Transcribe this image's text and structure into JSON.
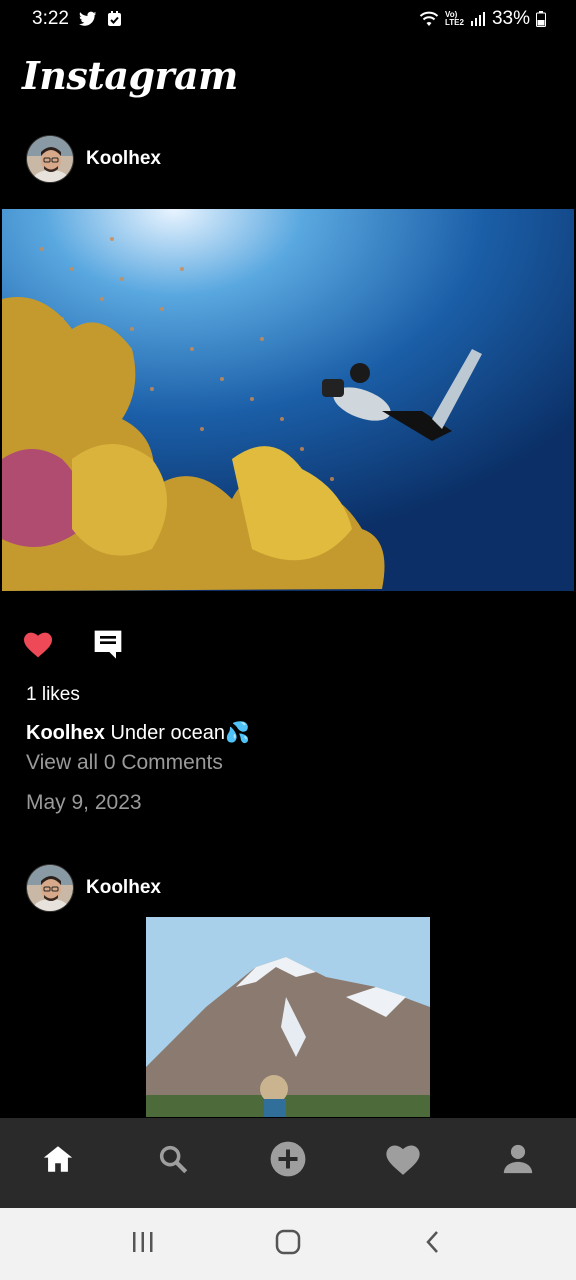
{
  "status_bar": {
    "time": "3:22",
    "battery": "33%",
    "network_top": "Vo)",
    "network_bottom": "LTE2"
  },
  "header": {
    "logo": "Instagram"
  },
  "posts": [
    {
      "username": "Koolhex",
      "likes": "1 likes",
      "caption_user": "Koolhex",
      "caption_text": "Under ocean💦",
      "comments": "View all 0 Comments",
      "date": "May 9, 2023",
      "liked": true
    },
    {
      "username": "Koolhex"
    }
  ],
  "bottom_nav": {
    "items": [
      "home-icon",
      "search-icon",
      "add-icon",
      "heart-icon",
      "profile-icon"
    ]
  },
  "system_nav": {
    "items": [
      "recent-apps-icon",
      "home-button-icon",
      "back-icon"
    ]
  },
  "colors": {
    "like_red": "#ed4956",
    "nav_bg": "#2a2a2a",
    "muted_text": "#9a9a9a"
  }
}
